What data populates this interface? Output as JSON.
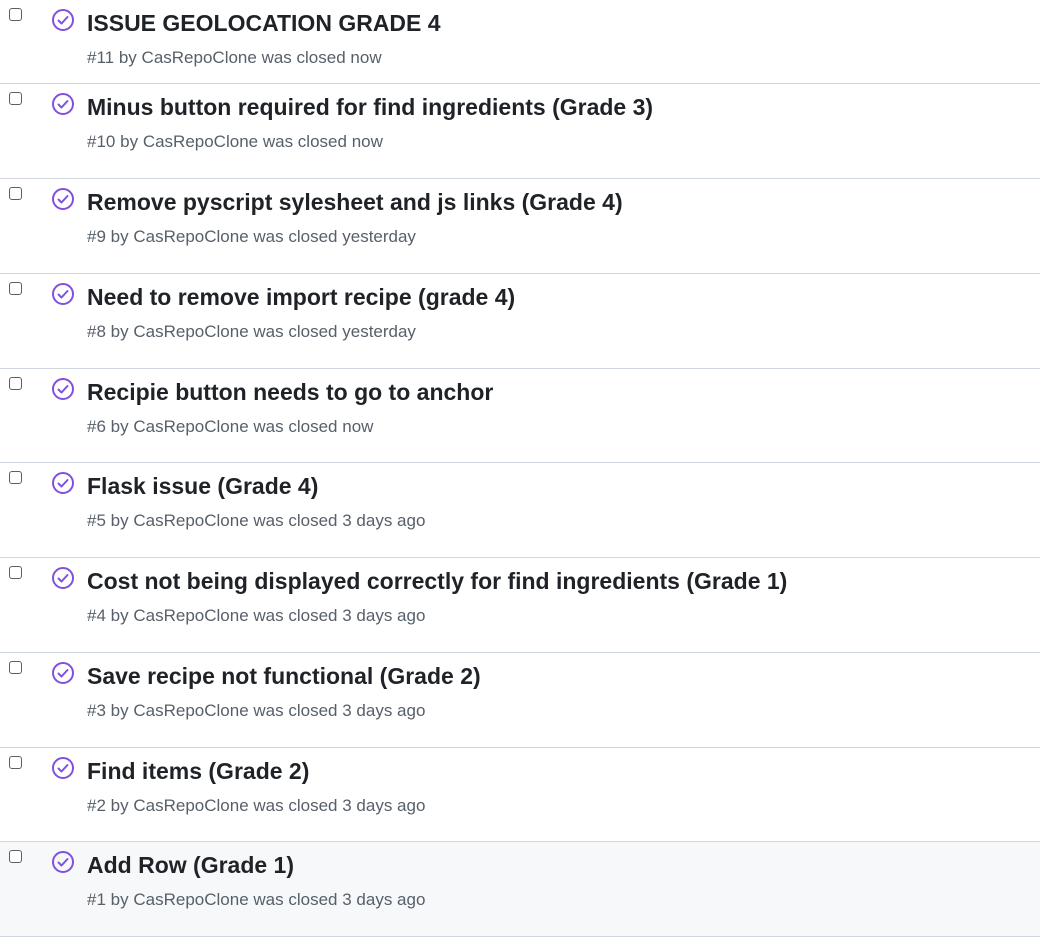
{
  "colors": {
    "closed_icon": "#8250df",
    "title": "#1f2328",
    "meta": "#57606a",
    "divider": "#d0d7de",
    "row_hover_bg": "#f6f8fa"
  },
  "icons": {
    "state": "issue-closed-check-circle-icon",
    "select": "checkbox"
  },
  "issues": [
    {
      "title": "ISSUE GEOLOCATION GRADE 4",
      "number": "#11",
      "by": "by",
      "author": "CasRepoClone",
      "status": "was closed",
      "when": "now"
    },
    {
      "title": "Minus button required for find ingredients (Grade 3)",
      "number": "#10",
      "by": "by",
      "author": "CasRepoClone",
      "status": "was closed",
      "when": "now"
    },
    {
      "title": "Remove pyscript sylesheet and js links (Grade 4)",
      "number": "#9",
      "by": "by",
      "author": "CasRepoClone",
      "status": "was closed",
      "when": "yesterday"
    },
    {
      "title": "Need to remove import recipe (grade 4)",
      "number": "#8",
      "by": "by",
      "author": "CasRepoClone",
      "status": "was closed",
      "when": "yesterday"
    },
    {
      "title": "Recipie button needs to go to anchor",
      "number": "#6",
      "by": "by",
      "author": "CasRepoClone",
      "status": "was closed",
      "when": "now"
    },
    {
      "title": "Flask issue (Grade 4)",
      "number": "#5",
      "by": "by",
      "author": "CasRepoClone",
      "status": "was closed",
      "when": "3 days ago"
    },
    {
      "title": "Cost not being displayed correctly for find ingredients (Grade 1)",
      "number": "#4",
      "by": "by",
      "author": "CasRepoClone",
      "status": "was closed",
      "when": "3 days ago"
    },
    {
      "title": "Save recipe not functional (Grade 2)",
      "number": "#3",
      "by": "by",
      "author": "CasRepoClone",
      "status": "was closed",
      "when": "3 days ago"
    },
    {
      "title": "Find items (Grade 2)",
      "number": "#2",
      "by": "by",
      "author": "CasRepoClone",
      "status": "was closed",
      "when": "3 days ago"
    },
    {
      "title": "Add Row (Grade 1)",
      "number": "#1",
      "by": "by",
      "author": "CasRepoClone",
      "status": "was closed",
      "when": "3 days ago"
    }
  ]
}
